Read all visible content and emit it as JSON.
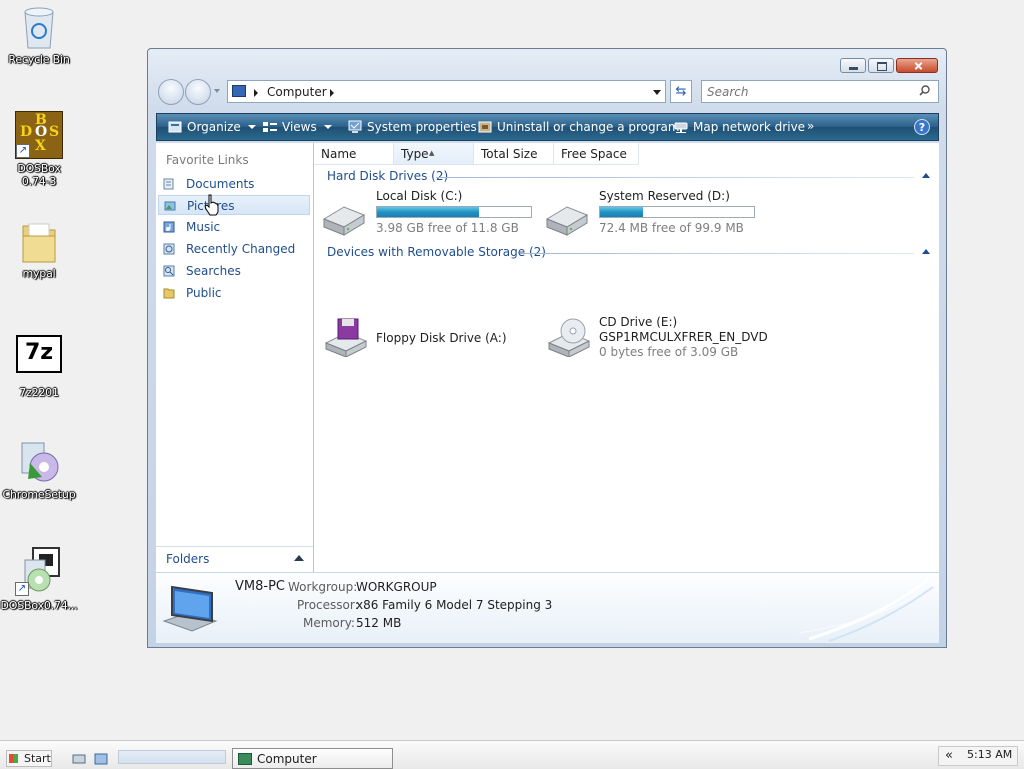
{
  "desktop": {
    "icons": [
      {
        "label": "Recycle Bin"
      },
      {
        "label": "DOSBox 0.74-3"
      },
      {
        "label": "mypal"
      },
      {
        "label": "7z2201"
      },
      {
        "label": "ChromeSetup"
      },
      {
        "label": "DOSBox0.74..."
      }
    ]
  },
  "window": {
    "address": {
      "location": "Computer"
    },
    "search": {
      "placeholder": "Search"
    },
    "toolbar": {
      "organize": "Organize",
      "views": "Views",
      "system_properties": "System properties",
      "uninstall": "Uninstall or change a program",
      "map_drive": "Map network drive",
      "more": "»"
    },
    "nav": {
      "title": "Favorite Links",
      "items": [
        {
          "label": "Documents"
        },
        {
          "label": "Pictures"
        },
        {
          "label": "Music"
        },
        {
          "label": "Recently Changed"
        },
        {
          "label": "Searches"
        },
        {
          "label": "Public"
        }
      ],
      "folders_label": "Folders"
    },
    "columns": [
      "Name",
      "Type",
      "Total Size",
      "Free Space"
    ],
    "groups": {
      "hard_disks": {
        "title": "Hard Disk Drives (2)",
        "drives": [
          {
            "name": "Local Disk (C:)",
            "free": "3.98 GB free of 11.8 GB",
            "used_fraction": 0.66
          },
          {
            "name": "System Reserved (D:)",
            "free": "72.4 MB free of 99.9 MB",
            "used_fraction": 0.28
          }
        ]
      },
      "removable": {
        "title": "Devices with Removable Storage (2)",
        "drives": [
          {
            "name": "Floppy Disk Drive (A:)"
          },
          {
            "name": "CD Drive (E:)",
            "label": "GSP1RMCULXFRER_EN_DVD",
            "free": "0 bytes free of 3.09 GB"
          }
        ]
      }
    },
    "details": {
      "computer_name": "VM8-PC",
      "workgroup_key": "Workgroup:",
      "workgroup_val": "WORKGROUP",
      "processor_key": "Processor:",
      "processor_val": "x86 Family 6 Model 7 Stepping 3",
      "memory_key": "Memory:",
      "memory_val": "512 MB"
    }
  },
  "taskbar": {
    "start": "Start",
    "task": "Computer",
    "clock": "5:13 AM",
    "tray_chevron": "«"
  },
  "colors": {
    "toolbar": "#2a5f88",
    "link": "#1f4e8c",
    "progress": "#2492c4"
  }
}
